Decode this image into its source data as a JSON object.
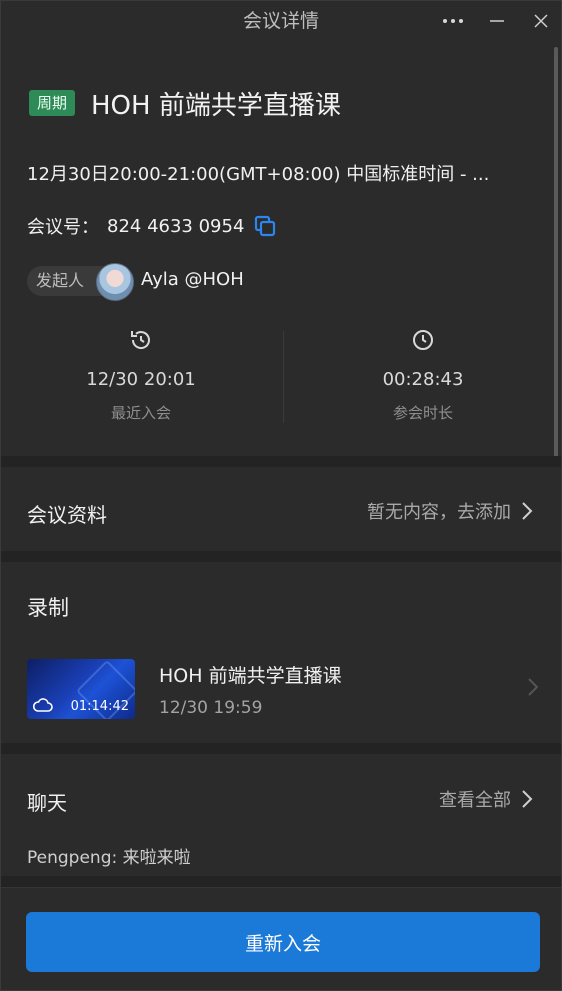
{
  "window": {
    "title": "会议详情"
  },
  "meeting": {
    "badge": "周期",
    "title": "HOH 前端共学直播课",
    "time": "12月30日20:00-21:00(GMT+08:00) 中国标准时间 - ...",
    "id_label": "会议号：",
    "id_value": "824 4633 0954"
  },
  "host": {
    "label": "发起人",
    "name": "Ayla @HOH"
  },
  "stats": {
    "last_join_value": "12/30 20:01",
    "last_join_label": "最近入会",
    "duration_value": "00:28:43",
    "duration_label": "参会时长"
  },
  "materials": {
    "title": "会议资料",
    "action": "暂无内容，去添加"
  },
  "recording": {
    "title": "录制",
    "item_title": "HOH 前端共学直播课",
    "item_date": "12/30 19:59",
    "item_duration": "01:14:42"
  },
  "chat": {
    "title": "聊天",
    "action": "查看全部",
    "last_message": "Pengpeng: 来啦来啦"
  },
  "footer": {
    "rejoin_label": "重新入会"
  },
  "colors": {
    "accent": "#1b7ad8",
    "badge": "#2e8b57",
    "background": "#2b2b2b"
  }
}
